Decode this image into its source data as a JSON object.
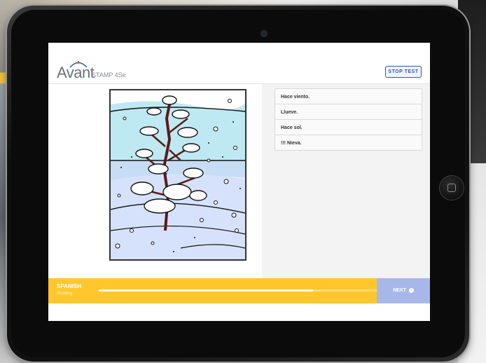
{
  "app": {
    "logo_word": "Avant",
    "product": "STAMP 4Se"
  },
  "header": {
    "stop_label": "STOP TEST"
  },
  "question": {
    "image_icon": "snowy-tree-image",
    "answers": [
      {
        "label": "Hace viento."
      },
      {
        "label": "Llueve."
      },
      {
        "label": "Hace sol."
      },
      {
        "label": "!!! Nieva."
      }
    ]
  },
  "footer": {
    "language": "SPANISH",
    "skill": "Reading",
    "progress": 0.77,
    "next_label": "NEXT",
    "next_icon": "arrow-right-circle-icon"
  },
  "colors": {
    "footer_bg": "#ffc72c",
    "next_bg": "#a7b8e8",
    "stop_border": "#2e5aa8"
  }
}
